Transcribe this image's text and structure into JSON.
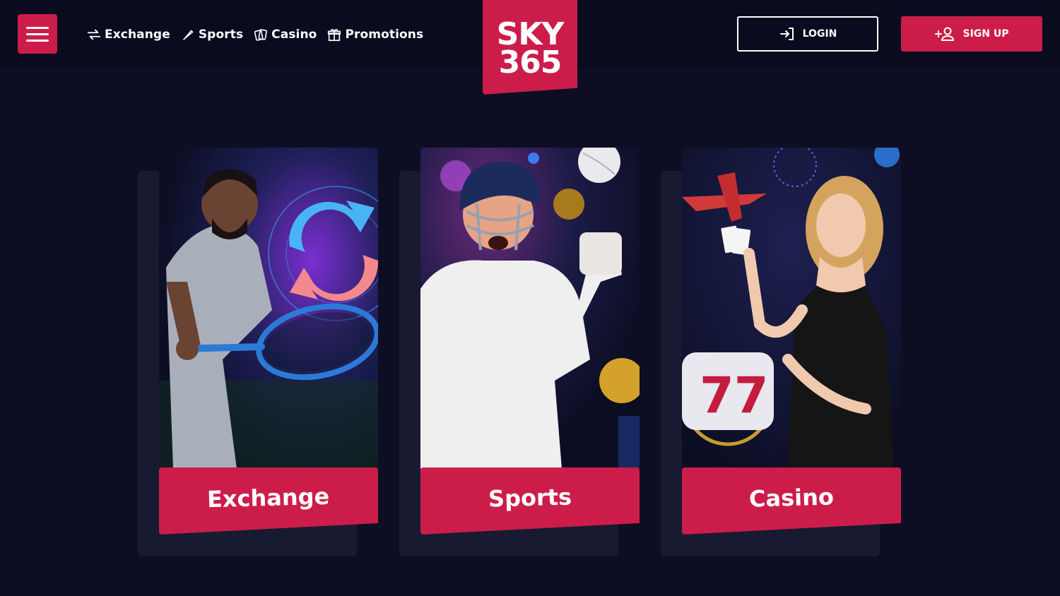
{
  "nav": {
    "items": [
      {
        "label": "Exchange",
        "icon": "exchange-arrows-icon"
      },
      {
        "label": "Sports",
        "icon": "bat-icon"
      },
      {
        "label": "Casino",
        "icon": "cards-icon"
      },
      {
        "label": "Promotions",
        "icon": "gift-icon"
      }
    ]
  },
  "logo": {
    "line1": "SKY",
    "line2": "365"
  },
  "auth": {
    "login_label": "LOGIN",
    "signup_label": "SIGN UP"
  },
  "cards": [
    {
      "title": "Exchange"
    },
    {
      "title": "Sports"
    },
    {
      "title": "Casino"
    }
  ],
  "colors": {
    "accent": "#cc1d4a",
    "background": "#0d0e23",
    "header": "#0a0b1f"
  }
}
